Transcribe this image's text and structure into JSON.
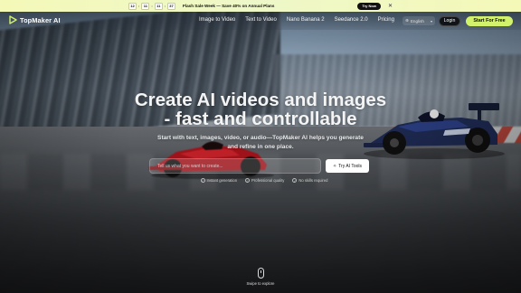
{
  "announcement": {
    "countdown": [
      "12",
      "11",
      "11",
      "37"
    ],
    "text": "Flash Sale Week — Save 40% on Annual Plans",
    "cta": "Try Now"
  },
  "nav": {
    "brand": "TopMaker AI",
    "links": [
      "Image to Video",
      "Text to Video",
      "Nano Banana 2",
      "Seedance 2.0",
      "Pricing"
    ],
    "language": "English",
    "login": "Login",
    "start": "Start For Free"
  },
  "hero": {
    "title_line1": "Create AI videos and images",
    "title_line2": "- fast and controllable",
    "subtitle": "Start with text, images, video, or audio—TopMaker AI helps you generate and refine in one place.",
    "prompt_placeholder": "Tell us what you want to create...",
    "cta": "Try AI Tools",
    "features": [
      "Instant generation",
      "Professional quality",
      "No skills required"
    ],
    "scroll_hint": "Swipe to explore"
  },
  "colors": {
    "announce_bg": "#f4f9b8",
    "accent": "#d3f26b",
    "login_bg": "#101418"
  }
}
